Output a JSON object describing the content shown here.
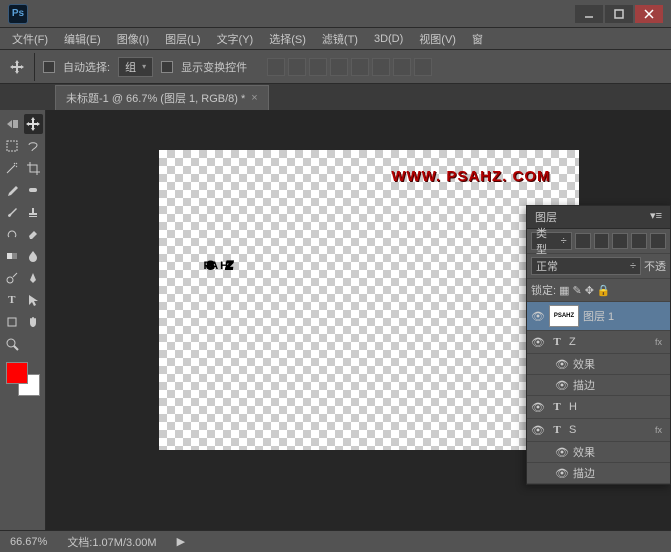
{
  "app": {
    "logo": "Ps"
  },
  "menus": [
    "文件(F)",
    "编辑(E)",
    "图像(I)",
    "图层(L)",
    "文字(Y)",
    "选择(S)",
    "滤镜(T)",
    "3D(D)",
    "视图(V)",
    "窗"
  ],
  "options": {
    "auto_select": "自动选择:",
    "group": "组",
    "show_transform": "显示变换控件"
  },
  "doc_tab": "未标题-1 @ 66.7% (图层 1, RGB/8) *",
  "watermark": "WWW. PSAHZ. COM",
  "logo_letters": [
    "P",
    "S",
    "A",
    "H",
    "Z"
  ],
  "layers_panel": {
    "title": "图层",
    "kind": "类型",
    "blend": "正常",
    "opacity_label": "不透",
    "lock_label": "锁定:",
    "layer1": "图层 1",
    "z": "Z",
    "h": "H",
    "s": "S",
    "fx": "效果",
    "stroke": "描边",
    "fx_tag": "fx"
  },
  "status": {
    "zoom": "66.67%",
    "doc": "文档:1.07M/3.00M"
  },
  "chart_data": null
}
